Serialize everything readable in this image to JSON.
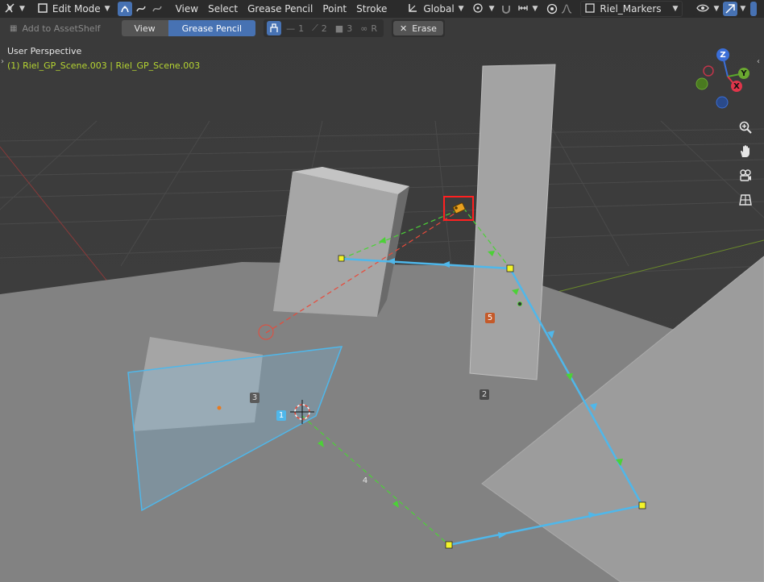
{
  "topbar": {
    "mode": "Edit Mode",
    "menus": [
      "View",
      "Select",
      "Grease Pencil",
      "Point",
      "Stroke"
    ],
    "orientation": "Global",
    "object": "Riel_Markers"
  },
  "toolbar": {
    "add_to_asset_shelf": "Add to AssetShelf",
    "view_tab": "View",
    "grease_pencil_tab": "Grease Pencil",
    "slot1": "1",
    "slot2": "2",
    "slot3": "3",
    "slot_r": "R",
    "erase": "Erase"
  },
  "viewport": {
    "title": "User Perspective",
    "object_info": "(1) Riel_GP_Scene.003 | Riel_GP_Scene.003",
    "gizmo": {
      "z": "Z",
      "y": "Y",
      "x": "X"
    },
    "labels": {
      "l1": "1",
      "l2": "2",
      "l3": "3",
      "l4": "4",
      "l5": "5"
    }
  },
  "colors": {
    "accent": "#4772b3",
    "stroke_blue": "#4fb7ea",
    "guide_green": "#4cd137",
    "guide_red": "#e84a3a",
    "point_yellow": "#f4f42a",
    "highlight_red": "#ff2020"
  },
  "icons": [
    "editor-type-icon",
    "object-type-icon",
    "select-mode-icon",
    "snap-icon",
    "magnet-icon",
    "proportional-icon",
    "visibility-icon",
    "overlay-icon",
    "zoom-icon",
    "hand-icon",
    "camera-icon",
    "grid-icon",
    "erase-icon"
  ]
}
